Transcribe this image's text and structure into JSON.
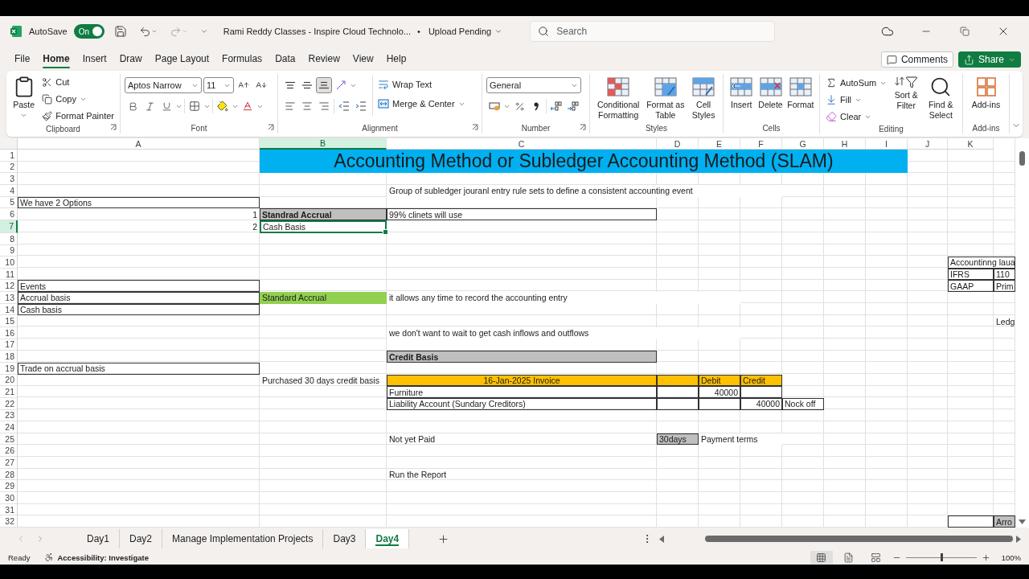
{
  "title_bar": {
    "autosave_label": "AutoSave",
    "autosave": {
      "label": "On",
      "on": true
    },
    "document_title": "Rami Reddy Classes - Inspire Cloud Technolo...",
    "status_dot": "•",
    "status": "Upload Pending",
    "search": {
      "placeholder": "Search"
    }
  },
  "menu_tabs": [
    {
      "label": "File",
      "selected": false
    },
    {
      "label": "Home",
      "selected": true
    },
    {
      "label": "Insert",
      "selected": false
    },
    {
      "label": "Draw",
      "selected": false
    },
    {
      "label": "Page Layout",
      "selected": false
    },
    {
      "label": "Formulas",
      "selected": false
    },
    {
      "label": "Data",
      "selected": false
    },
    {
      "label": "Review",
      "selected": false
    },
    {
      "label": "View",
      "selected": false
    },
    {
      "label": "Help",
      "selected": false
    }
  ],
  "actions": {
    "comments": "Comments",
    "share": "Share"
  },
  "ribbon": {
    "clipboard": {
      "paste": "Paste",
      "cut": "Cut",
      "copy": "Copy",
      "format_painter": "Format Painter",
      "label": "Clipboard"
    },
    "font": {
      "name": "Aptos Narrow",
      "size": "11",
      "label": "Font"
    },
    "alignment": {
      "vertical_buttons": [
        {
          "selected": false
        },
        {
          "selected": false
        },
        {
          "selected": true
        }
      ],
      "wrap": "Wrap Text",
      "merge": "Merge & Center",
      "label": "Alignment"
    },
    "number": {
      "format": "General",
      "label": "Number"
    },
    "styles": {
      "conditional": "Conditional Formatting",
      "format_table": "Format as Table",
      "cell_styles": "Cell Styles",
      "label": "Styles"
    },
    "cells": {
      "insert": "Insert",
      "delete": "Delete",
      "format": "Format",
      "label": "Cells"
    },
    "editing": {
      "autosum": "AutoSum",
      "fill": "Fill",
      "clear": "Clear",
      "sort": "Sort & Filter",
      "find": "Find & Select",
      "label": "Editing"
    },
    "addins": {
      "button": "Add-ins",
      "label": "Add-ins"
    }
  },
  "sheet": {
    "columns": [
      {
        "label": "A",
        "selected": false
      },
      {
        "label": "B",
        "selected": true
      },
      {
        "label": "C",
        "selected": false
      },
      {
        "label": "D",
        "selected": false
      },
      {
        "label": "E",
        "selected": false
      },
      {
        "label": "F",
        "selected": false
      },
      {
        "label": "G",
        "selected": false
      },
      {
        "label": "H",
        "selected": false
      },
      {
        "label": "I",
        "selected": false
      },
      {
        "label": "J",
        "selected": false
      },
      {
        "label": "K",
        "selected": false
      }
    ],
    "rows": [
      {
        "label": "1",
        "selected": false
      },
      {
        "label": "2",
        "selected": false
      },
      {
        "label": "3",
        "selected": false
      },
      {
        "label": "4",
        "selected": false
      },
      {
        "label": "5",
        "selected": false
      },
      {
        "label": "6",
        "selected": false
      },
      {
        "label": "7",
        "selected": true
      },
      {
        "label": "8",
        "selected": false
      },
      {
        "label": "9",
        "selected": false
      },
      {
        "label": "10",
        "selected": false
      },
      {
        "label": "11",
        "selected": false
      },
      {
        "label": "12",
        "selected": false
      },
      {
        "label": "13",
        "selected": false
      },
      {
        "label": "14",
        "selected": false
      },
      {
        "label": "15",
        "selected": false
      },
      {
        "label": "16",
        "selected": false
      },
      {
        "label": "17",
        "selected": false
      },
      {
        "label": "18",
        "selected": false
      },
      {
        "label": "19",
        "selected": false
      },
      {
        "label": "20",
        "selected": false
      },
      {
        "label": "21",
        "selected": false
      },
      {
        "label": "22",
        "selected": false
      },
      {
        "label": "23",
        "selected": false
      },
      {
        "label": "24",
        "selected": false
      },
      {
        "label": "25",
        "selected": false
      },
      {
        "label": "26",
        "selected": false
      },
      {
        "label": "27",
        "selected": false
      },
      {
        "label": "28",
        "selected": false
      },
      {
        "label": "29",
        "selected": false
      },
      {
        "label": "30",
        "selected": false
      },
      {
        "label": "31",
        "selected": false
      },
      {
        "label": "32",
        "selected": false
      }
    ],
    "cells": [
      {
        "kind": "title",
        "text": "Accounting Method or Subledger Accounting Method (SLAM)",
        "bordered": false,
        "selected": false
      },
      {
        "kind": "text",
        "text": "Group of subledger jouranl entry rule sets to define a consistent accounting event",
        "bordered": false,
        "selected": false
      },
      {
        "kind": "text",
        "text": "We have 2 Options",
        "bordered": true,
        "selected": false
      },
      {
        "kind": "number",
        "text": "1",
        "bordered": false,
        "selected": false
      },
      {
        "kind": "header",
        "text": "Standrad Accrual",
        "bordered": true,
        "selected": false
      },
      {
        "kind": "text",
        "text": "99% clinets will use",
        "bordered": true,
        "selected": false
      },
      {
        "kind": "number",
        "text": "2",
        "bordered": false,
        "selected": false
      },
      {
        "kind": "text",
        "text": "Cash Basis",
        "bordered": false,
        "selected": true
      },
      {
        "kind": "text",
        "text": "Accountinng laua",
        "bordered": true,
        "selected": false
      },
      {
        "kind": "text",
        "text": "IFRS",
        "bordered": true,
        "selected": false
      },
      {
        "kind": "text",
        "text": "110",
        "bordered": true,
        "selected": false
      },
      {
        "kind": "text",
        "text": "Events",
        "bordered": true,
        "selected": false
      },
      {
        "kind": "text",
        "text": "GAAP",
        "bordered": true,
        "selected": false
      },
      {
        "kind": "text",
        "text": "Prim",
        "bordered": true,
        "selected": false
      },
      {
        "kind": "text",
        "text": "Accrual basis",
        "bordered": true,
        "selected": false
      },
      {
        "kind": "green",
        "text": "Standard Accrual",
        "bordered": false,
        "selected": false
      },
      {
        "kind": "text",
        "text": "it allows any time to record the accounting entry",
        "bordered": false,
        "selected": false
      },
      {
        "kind": "text",
        "text": "Cash basis",
        "bordered": true,
        "selected": false
      },
      {
        "kind": "text",
        "text": "Ledg",
        "bordered": false,
        "selected": false
      },
      {
        "kind": "text",
        "text": "we don't want to wait to get cash inflows and outflows",
        "bordered": false,
        "selected": false
      },
      {
        "kind": "header",
        "text": "Credit Basis",
        "bordered": true,
        "selected": false
      },
      {
        "kind": "text",
        "text": "Trade on accrual basis",
        "bordered": true,
        "selected": false
      },
      {
        "kind": "text",
        "text": "Purchased 30 days credit basis",
        "bordered": false,
        "selected": false
      },
      {
        "kind": "orange-center",
        "text": "16-Jan-2025 Invoice",
        "bordered": true,
        "selected": false
      },
      {
        "kind": "orange",
        "text": "Debit",
        "bordered": true,
        "selected": false
      },
      {
        "kind": "orange",
        "text": "Credit",
        "bordered": true,
        "selected": false
      },
      {
        "kind": "text",
        "text": "Furniture",
        "bordered": true,
        "selected": false
      },
      {
        "kind": "number",
        "text": "40000",
        "bordered": true,
        "selected": false
      },
      {
        "kind": "text",
        "text": "Liability Account (Sundary Creditors)",
        "bordered": true,
        "selected": false
      },
      {
        "kind": "number",
        "text": "40000",
        "bordered": true,
        "selected": false
      },
      {
        "kind": "text",
        "text": "Nock off",
        "bordered": true,
        "selected": false
      },
      {
        "kind": "text",
        "text": "Not yet Paid",
        "bordered": false,
        "selected": false
      },
      {
        "kind": "gray",
        "text": "30days",
        "bordered": true,
        "selected": false
      },
      {
        "kind": "text",
        "text": "Payment terms",
        "bordered": false,
        "selected": false
      },
      {
        "kind": "text",
        "text": "Run the Report",
        "bordered": false,
        "selected": false
      },
      {
        "kind": "gray",
        "text": "Arro",
        "bordered": true,
        "selected": false
      }
    ]
  },
  "sheet_tabs": [
    {
      "label": "Day1",
      "selected": false
    },
    {
      "label": "Day2",
      "selected": false
    },
    {
      "label": "Manage Implementation Projects",
      "selected": false
    },
    {
      "label": "Day3",
      "selected": false
    },
    {
      "label": "Day4",
      "selected": true
    }
  ],
  "status_bar": {
    "ready": "Ready",
    "accessibility": "Accessibility: Investigate",
    "zoom": {
      "level": 0.5,
      "reading": "100%"
    }
  }
}
